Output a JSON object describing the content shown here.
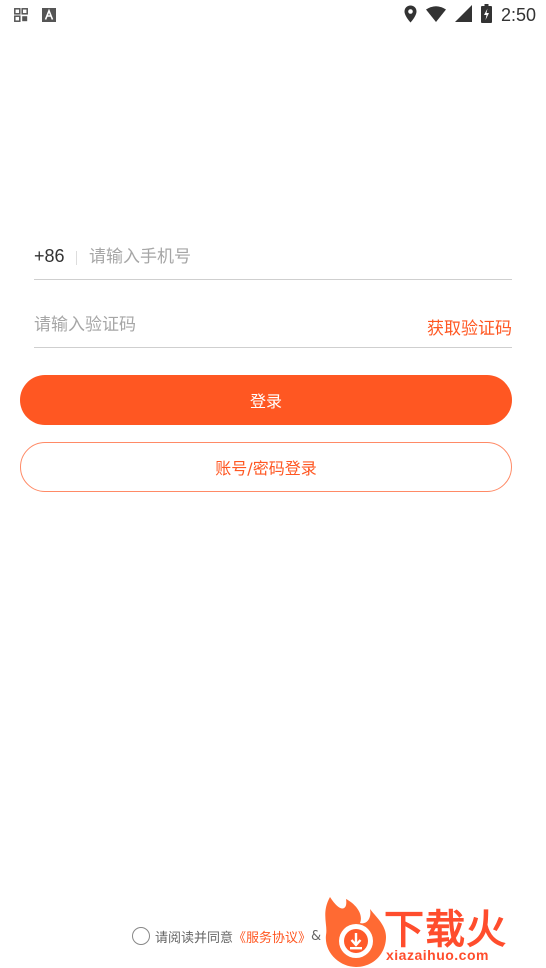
{
  "status_bar": {
    "time": "2:50",
    "left_icons": [
      "screen-record-icon",
      "font-a-icon"
    ],
    "right_icons": [
      "location-icon",
      "wifi-icon",
      "signal-icon",
      "battery-charging-icon"
    ]
  },
  "login_form": {
    "country_code": "+86",
    "phone_placeholder": "请输入手机号",
    "code_placeholder": "请输入验证码",
    "get_code_label": "获取验证码",
    "login_button": "登录",
    "account_login_button": "账号/密码登录"
  },
  "agreement": {
    "prefix": "请阅读并同意",
    "service_link": "《服务协议》",
    "trailing": "&"
  },
  "watermark": {
    "title": "下载火",
    "domain": "xiazaihuo.com"
  },
  "colors": {
    "accent": "#ff5722",
    "outline": "#ff8a66",
    "divider": "#cfcfcf",
    "placeholder": "#a6a6a6"
  }
}
